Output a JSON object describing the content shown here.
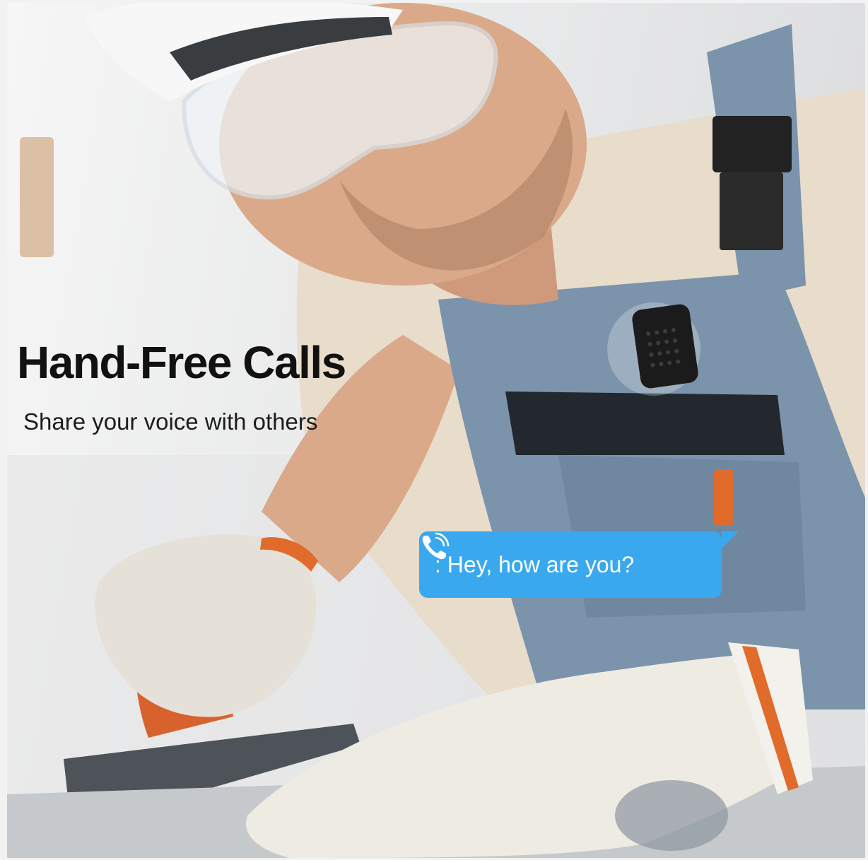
{
  "headline": "Hand-Free Calls",
  "subheadline": "Share your voice with others",
  "chat_bubble": {
    "icon": "phone-sound-icon",
    "message": ": Hey, how are you?",
    "color": "#3aa8ee"
  },
  "palette": {
    "apron": "#7b93ab",
    "shirt": "#e8dccb",
    "skin": "#d9a989",
    "glove": "#eeebe3",
    "accent_orange": "#e06b2a"
  }
}
